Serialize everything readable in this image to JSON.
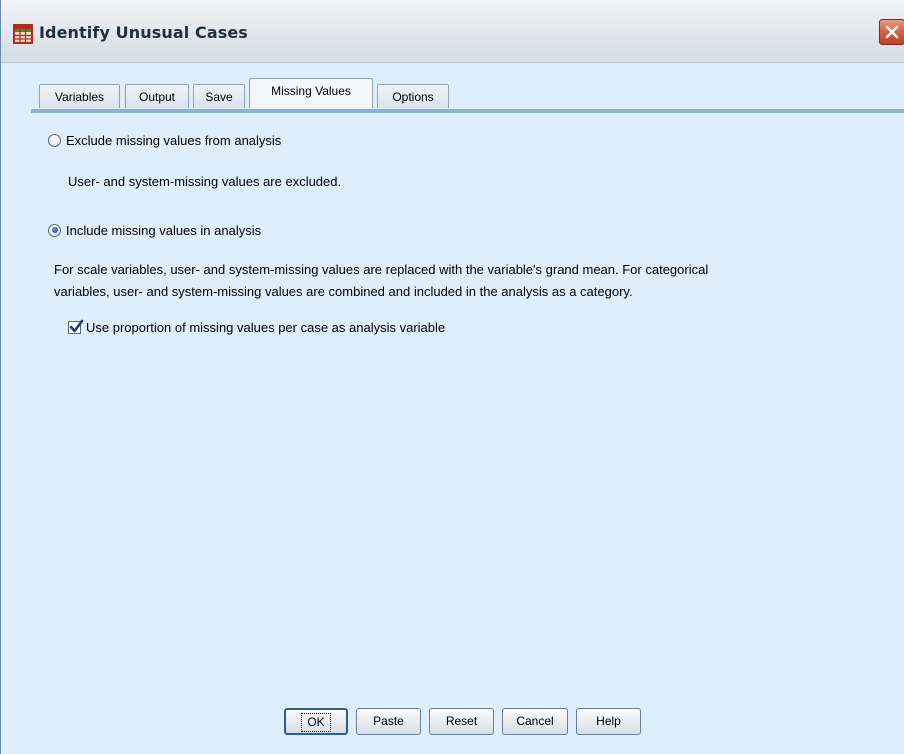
{
  "window": {
    "title": "Identify Unusual Cases",
    "icon": "grid-app-icon",
    "close_icon": "close-x-icon",
    "accent": "#8db0d4",
    "close_color": "#d25c3d"
  },
  "tabs": [
    {
      "label": "Variables",
      "active": false
    },
    {
      "label": "Output",
      "active": false
    },
    {
      "label": "Save",
      "active": false
    },
    {
      "label": "Missing Values",
      "active": true
    },
    {
      "label": "Options",
      "active": false
    }
  ],
  "content": {
    "exclude_option": {
      "label": "Exclude missing values from analysis",
      "checked": false
    },
    "exclude_desc": "User- and system-missing values are excluded.",
    "include_option": {
      "label": "Include missing values in analysis",
      "checked": true
    },
    "include_desc_line1": "For scale variables, user- and system-missing values are replaced with the variable's grand mean. For categorical",
    "include_desc_line2": "variables, user- and system-missing values are combined and included in the analysis as a category.",
    "proportion_checkbox": {
      "label": "Use proportion of missing values per case as analysis variable",
      "checked": true
    }
  },
  "buttons": {
    "ok": "OK",
    "paste": "Paste",
    "reset": "Reset",
    "cancel": "Cancel",
    "help": "Help"
  }
}
